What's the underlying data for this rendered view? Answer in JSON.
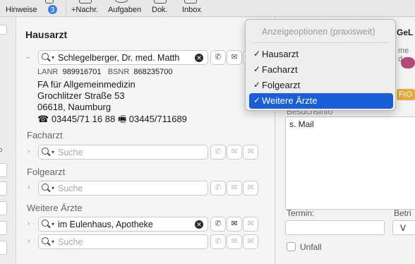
{
  "toolbar": {
    "hinweise": "Hinweise",
    "badge": "3",
    "nachr": "+Nachr.",
    "aufgaben": "Aufgaben",
    "dok": "Dok.",
    "inbox": "Inbox"
  },
  "main": {
    "title": "Hausarzt",
    "hausarzt": {
      "value": "Schlegelberger, Dr. med. Matth",
      "lanr_label": "LANR",
      "lanr": "989916701",
      "bsnr_label": "BSNR",
      "bsnr": "868235700",
      "specialty": "FA für Allgemeinmedizin",
      "street": "Grochlitzer Straße 53",
      "city": "06618, Naumburg",
      "phone": "03445/71 16 88",
      "fax": "03445/711689"
    },
    "facharzt": {
      "label": "Facharzt",
      "placeholder": "Suche"
    },
    "folgearzt": {
      "label": "Folgearzt",
      "placeholder": "Suche"
    },
    "weitere": {
      "label": "Weitere Ärzte",
      "value": "im Eulenhaus, Apotheke",
      "placeholder": "Suche"
    }
  },
  "menu": {
    "header": "Anzeigeoptionen (praxisweit)",
    "items": [
      {
        "label": "Hausarzt",
        "checked": true
      },
      {
        "label": "Facharzt",
        "checked": true
      },
      {
        "label": "Folgearzt",
        "checked": true
      },
      {
        "label": "Weitere Ärzte",
        "checked": true,
        "selected": true
      }
    ]
  },
  "right": {
    "title": "GeL",
    "partial": "me d",
    "tag": "FrO",
    "besuchsinfo_label": "Besuchsinfo",
    "besuchsinfo_text": "s. Mail",
    "termin_label": "Termin:",
    "betr_label": "Betri",
    "betr_value": "V",
    "unfall_label": "Unfall"
  },
  "colors": {
    "accent": "#1a5ed8",
    "badge": "#3d7fe0",
    "tag": "#e8a93c"
  }
}
